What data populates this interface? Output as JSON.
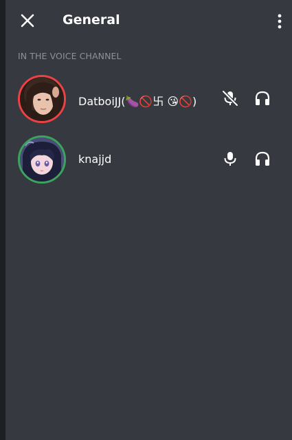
{
  "header": {
    "title": "General",
    "close_icon": "close-icon",
    "more_icon": "more-vertical-icon"
  },
  "section": {
    "label": "IN THE VOICE CHANNEL"
  },
  "members": [
    {
      "name": "DatboiJJ(🍆🚫卐 😘🚫)",
      "ring_color": "#ed4245",
      "mic_icon": "microphone-muted-icon",
      "audio_icon": "headphones-icon"
    },
    {
      "name": "knajjd",
      "ring_color": "#3ba55d",
      "mic_icon": "microphone-icon",
      "audio_icon": "headphones-icon"
    }
  ],
  "colors": {
    "background": "#36393f",
    "text": "#ffffff",
    "muted_text": "#8e9297",
    "speaking_ring": "#3ba55d",
    "muted_ring": "#ed4245"
  }
}
